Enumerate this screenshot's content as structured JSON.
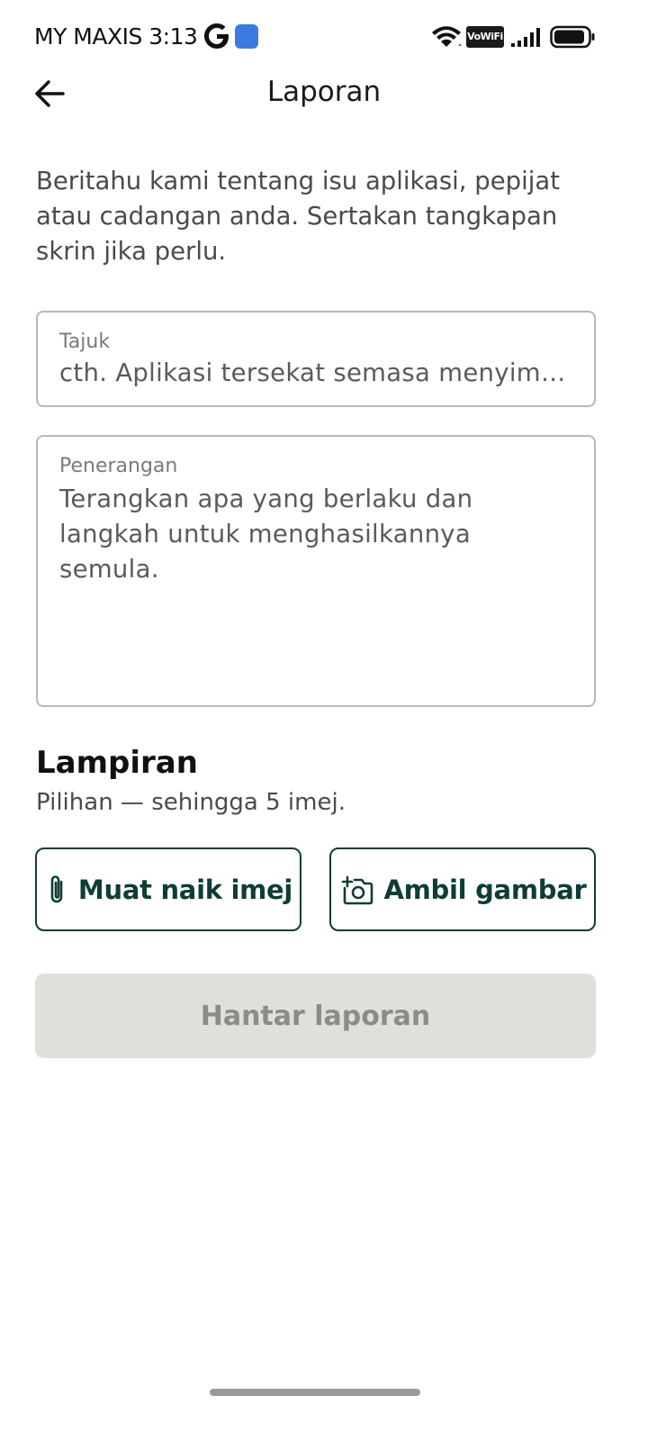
{
  "status_bar": {
    "carrier_time": "MY MAXIS 3:13",
    "vowifi_label": "VoWiFi",
    "icons": [
      "google-icon",
      "app-badge-icon",
      "wifi-icon",
      "signal-icon",
      "battery-icon"
    ]
  },
  "header": {
    "title": "Laporan",
    "back_icon": "arrow-left-icon"
  },
  "intro_text": "Beritahu kami tentang isu aplikasi, pepijat atau cadangan anda. Sertakan tangkapan skrin jika perlu.",
  "form": {
    "title_field": {
      "label": "Tajuk",
      "placeholder": "cth. Aplikasi tersekat semasa menyimpan"
    },
    "description_field": {
      "label": "Penerangan",
      "placeholder": "Terangkan apa yang berlaku dan langkah untuk menghasilkannya semula."
    }
  },
  "attachments": {
    "title": "Lampiran",
    "subtitle": "Pilihan — sehingga 5 imej.",
    "upload_label": "Muat naik imej",
    "camera_label": "Ambil gambar"
  },
  "submit_label": "Hantar laporan",
  "colors": {
    "accent": "#0f3d36",
    "disabled_bg": "#e0e0da",
    "disabled_text": "#8c8c86"
  }
}
